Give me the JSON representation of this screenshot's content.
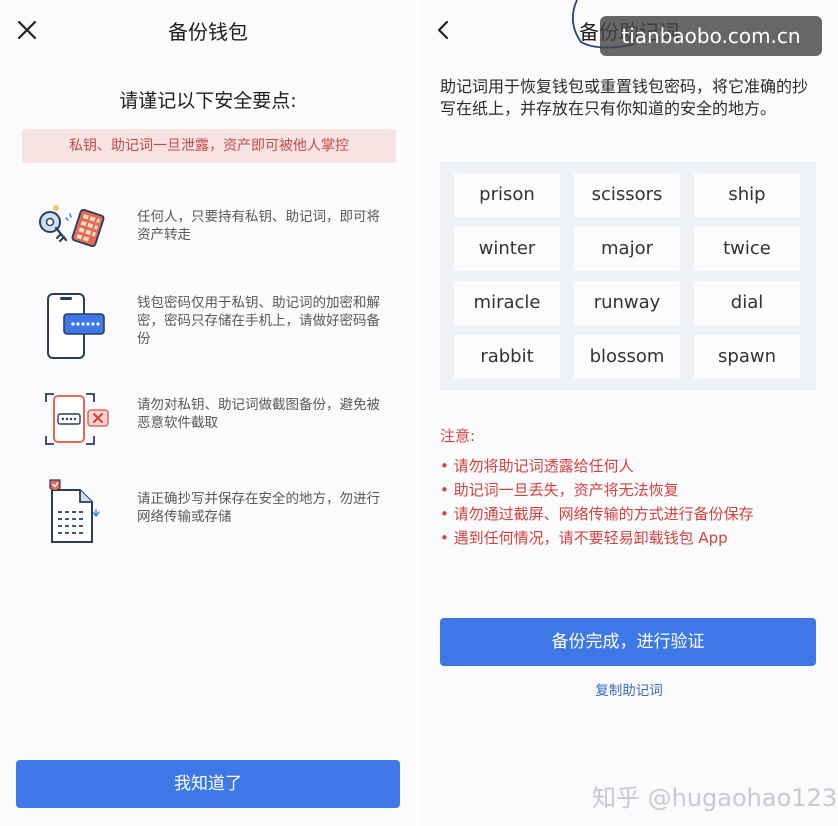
{
  "left": {
    "title": "备份钱包",
    "subtitle": "请谨记以下安全要点:",
    "warning": "私钥、助记词一旦泄露，资产即可被他人掌控",
    "tips": [
      "任何人，只要持有私钥、助记词，即可将资产转走",
      "钱包密码仅用于私钥、助记词的加密和解密，密码只存储在手机上，请做好密码备份",
      "请勿对私钥、助记词做截图备份，避免被恶意软件截取",
      "请正确抄写并保存在安全的地方，勿进行网络传输或存储"
    ],
    "button": "我知道了"
  },
  "right": {
    "title": "备份助记词",
    "intro": "助记词用于恢复钱包或重置钱包密码，将它准确的抄写在纸上，并存放在只有你知道的安全的地方。",
    "words": [
      "prison",
      "scissors",
      "ship",
      "winter",
      "major",
      "twice",
      "miracle",
      "runway",
      "dial",
      "rabbit",
      "blossom",
      "spawn"
    ],
    "notes_title": "注意:",
    "notes": [
      "• 请勿将助记词透露给任何人",
      "• 助记词一旦丢失，资产将无法恢复",
      "• 请勿通过截屏、网络传输的方式进行备份保存",
      "• 遇到任何情况，请不要轻易卸载钱包 App"
    ],
    "button": "备份完成，进行验证",
    "copy_link": "复制助记词"
  },
  "watermark": {
    "top": "tianbaobo.com.cn",
    "bottom": "知乎 @hugaohao123"
  },
  "colors": {
    "primary": "#3d78e6",
    "danger": "#d3423f",
    "warning_bg": "#f8e3e3",
    "link": "#3a68c4"
  }
}
